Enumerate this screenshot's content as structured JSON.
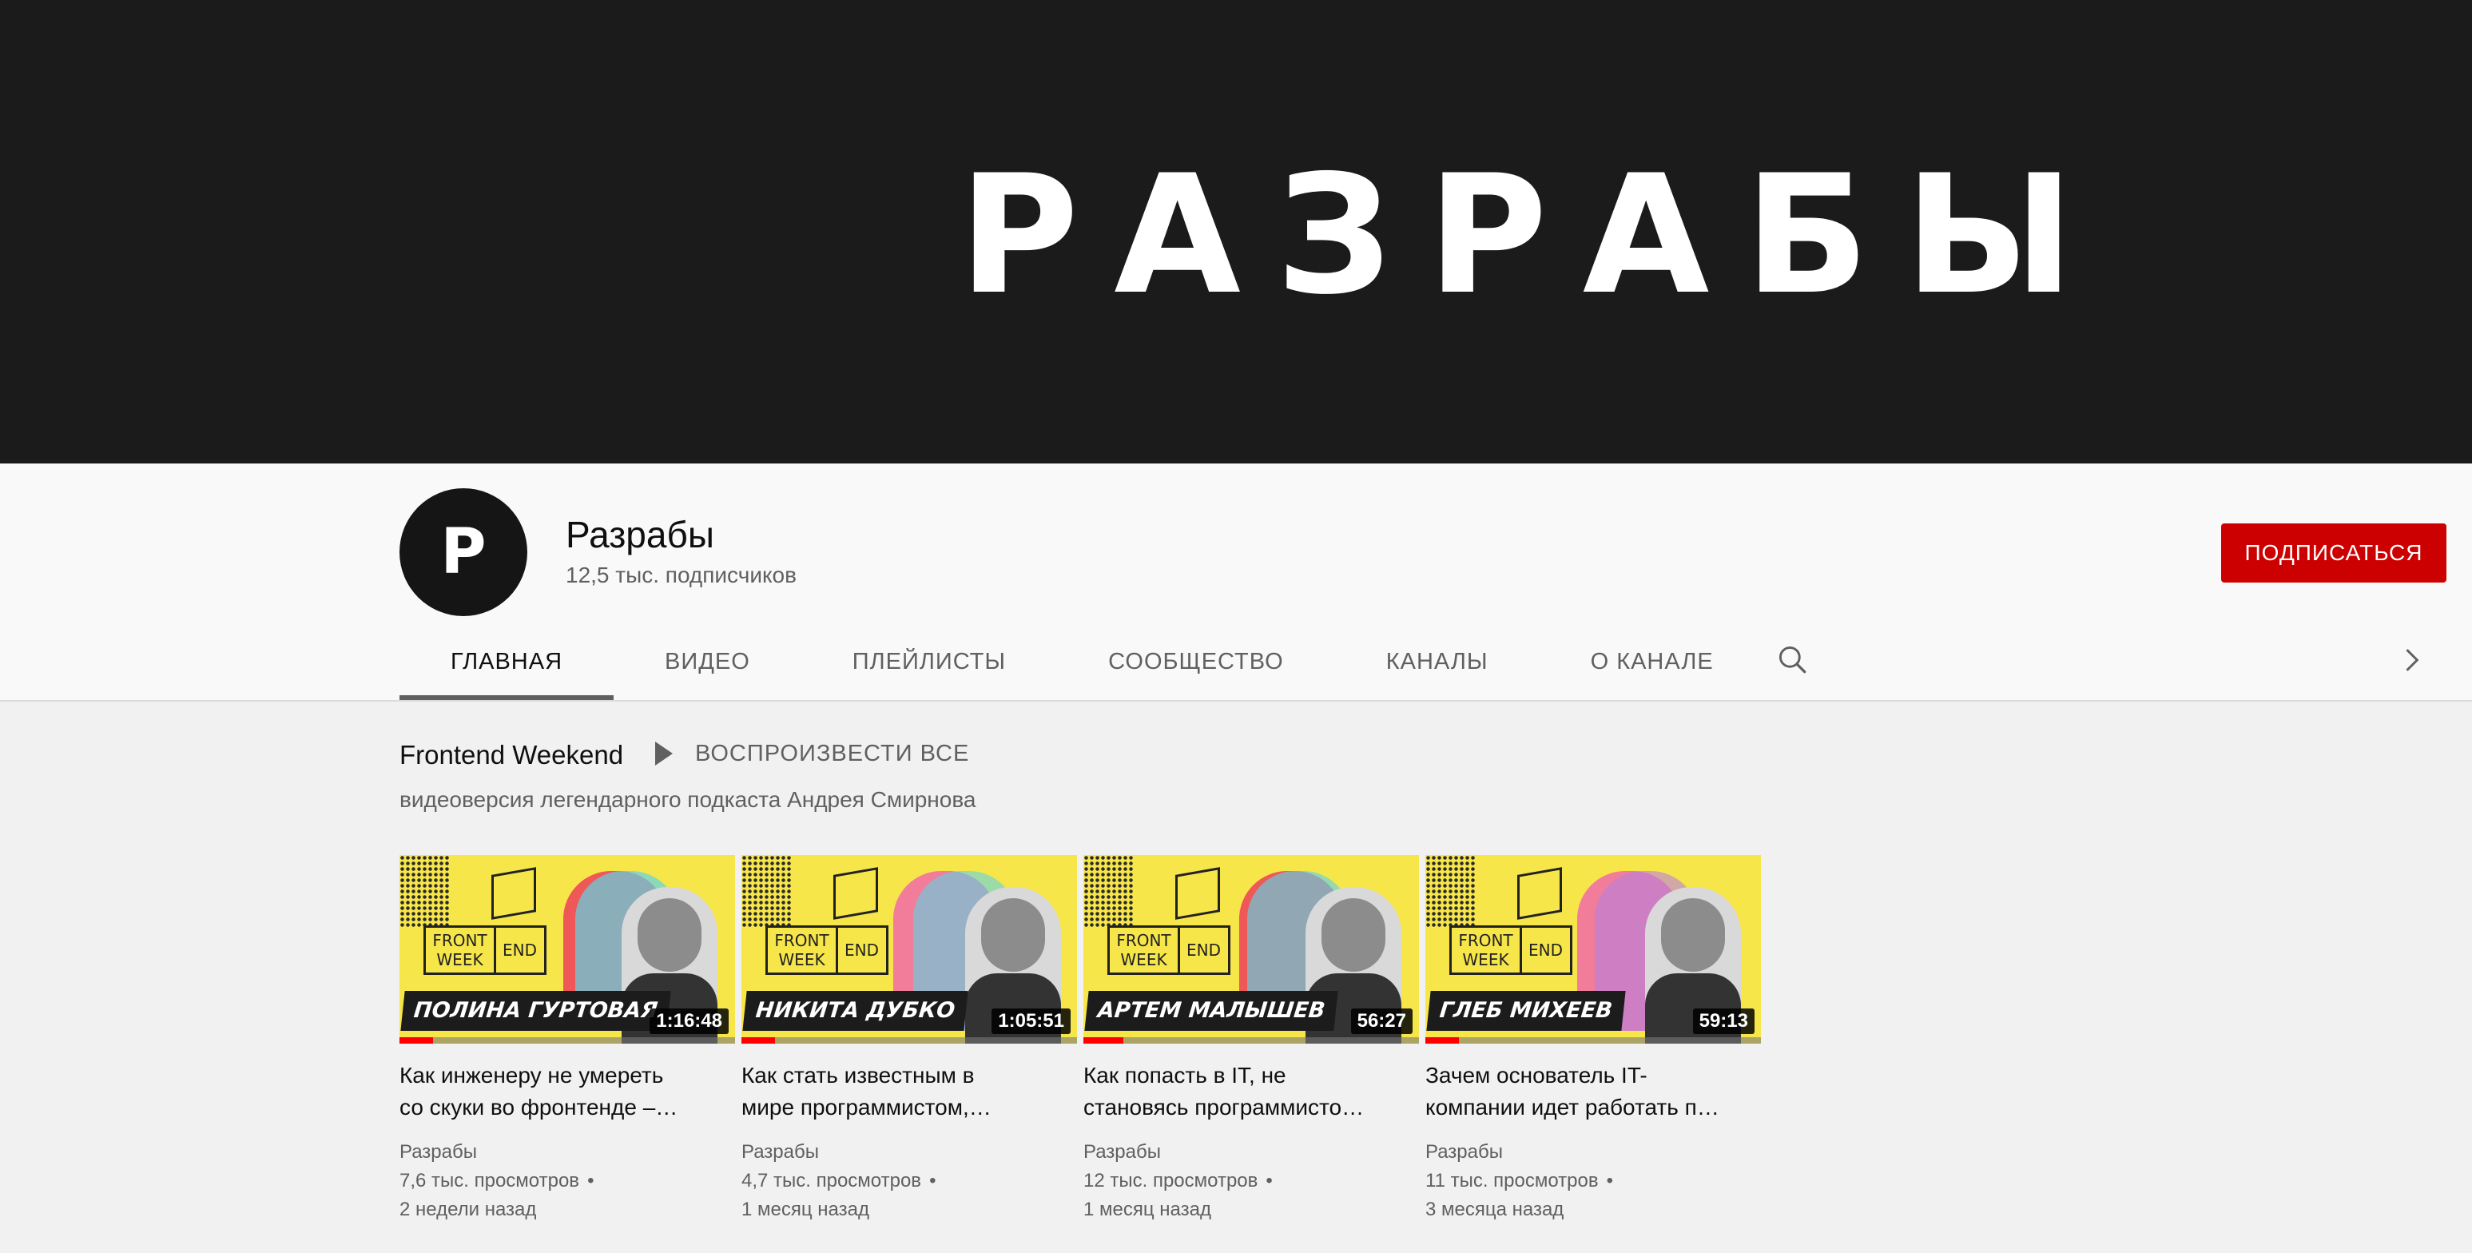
{
  "banner": {
    "text": "РАЗРАБЫ",
    "background": "#1b1b1b"
  },
  "channel": {
    "avatar_letter": "P",
    "name": "Разрабы",
    "subscribers": "12,5 тыс. подписчиков",
    "subscribe_label": "ПОДПИСАТЬСЯ"
  },
  "tabs": [
    {
      "label": "ГЛАВНАЯ",
      "active": true
    },
    {
      "label": "ВИДЕО",
      "active": false
    },
    {
      "label": "ПЛЕЙЛИСТЫ",
      "active": false
    },
    {
      "label": "СООБЩЕСТВО",
      "active": false
    },
    {
      "label": "КАНАЛЫ",
      "active": false
    },
    {
      "label": "О КАНАЛЕ",
      "active": false
    }
  ],
  "icons": {
    "search": "search-icon",
    "next": "chevron-right-icon"
  },
  "section": {
    "title": "Frontend Weekend",
    "play_all_label": "ВОСПРОИЗВЕСТИ ВСЕ",
    "description": "видеоверсия легендарного подкаста Андрея Смирнова"
  },
  "thumb_common": {
    "front": "FRONT",
    "week": "WEEK",
    "end": "END"
  },
  "videos": [
    {
      "thumb_name": "ПОЛИНА ГУРТОВАЯ",
      "duration": "1:16:48",
      "progress": 0.1,
      "title_line1": "Как инженеру не умереть",
      "title_line2": "со скуки во фронтенде –…",
      "channel": "Разрабы",
      "views": "7,6 тыс. просмотров",
      "dot": "•",
      "age": "2 недели назад"
    },
    {
      "thumb_name": "НИКИТА ДУБКО",
      "duration": "1:05:51",
      "progress": 0.1,
      "title_line1": "Как стать известным в",
      "title_line2": "мире программистом,…",
      "channel": "Разрабы",
      "views": "4,7 тыс. просмотров",
      "dot": "•",
      "age": "1 месяц назад"
    },
    {
      "thumb_name": "АРТЕМ МАЛЫШЕВ",
      "duration": "56:27",
      "progress": 0.12,
      "title_line1": "Как попасть в IT, не",
      "title_line2": "становясь программисто…",
      "channel": "Разрабы",
      "views": "12 тыс. просмотров",
      "dot": "•",
      "age": "1 месяц назад"
    },
    {
      "thumb_name": "ГЛЕБ МИХЕЕВ",
      "duration": "59:13",
      "progress": 0.1,
      "title_line1": "Зачем основатель IT-",
      "title_line2": "компании идет работать п…",
      "channel": "Разрабы",
      "views": "11 тыс. просмотров",
      "dot": "•",
      "age": "3 месяца назад"
    }
  ],
  "colors": {
    "subscribe": "#cc0000",
    "thumb_bg": "#f7e64a",
    "progress": "#ff0000"
  }
}
